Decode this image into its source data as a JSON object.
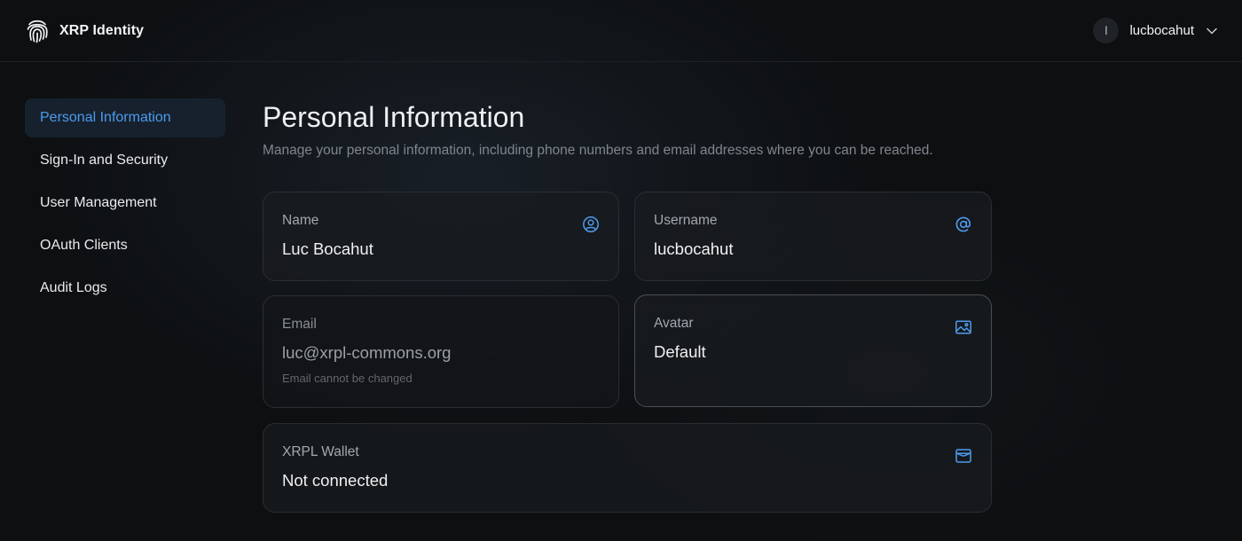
{
  "app": {
    "name": "XRP Identity"
  },
  "user": {
    "initial": "l",
    "username": "lucbocahut"
  },
  "sidebar": {
    "items": [
      {
        "label": "Personal Information",
        "active": true
      },
      {
        "label": "Sign-In and Security",
        "active": false
      },
      {
        "label": "User Management",
        "active": false
      },
      {
        "label": "OAuth Clients",
        "active": false
      },
      {
        "label": "Audit Logs",
        "active": false
      }
    ]
  },
  "page": {
    "title": "Personal Information",
    "subtitle": "Manage your personal information, including phone numbers and email addresses where you can be reached."
  },
  "fields": {
    "name": {
      "label": "Name",
      "value": "Luc Bocahut",
      "icon": "user-circle-icon"
    },
    "username": {
      "label": "Username",
      "value": "lucbocahut",
      "icon": "at-sign-icon"
    },
    "email": {
      "label": "Email",
      "value": "luc@xrpl-commons.org",
      "hint": "Email cannot be changed"
    },
    "avatar": {
      "label": "Avatar",
      "value": "Default",
      "icon": "image-icon"
    },
    "wallet": {
      "label": "XRPL Wallet",
      "value": "Not connected",
      "icon": "wallet-icon"
    }
  },
  "colors": {
    "accent": "#4d9bf0",
    "background": "#0d0f11",
    "active_bg": "#16212d"
  }
}
